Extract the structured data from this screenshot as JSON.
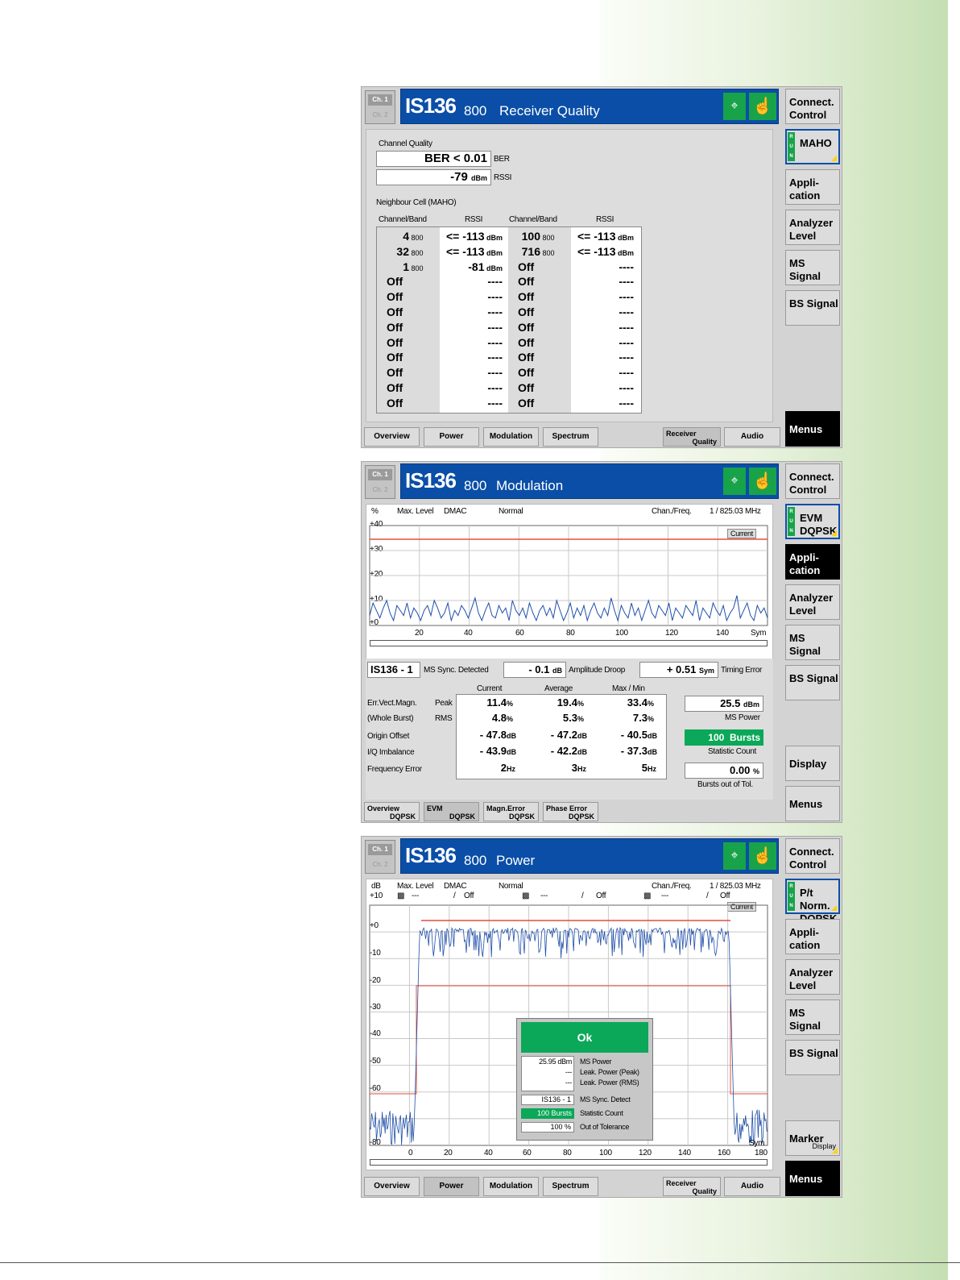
{
  "screen1": {
    "ch1": "Ch. 1",
    "ch2": "Ch. 2",
    "system": "IS136",
    "band": "800",
    "title": "Receiver Quality",
    "channel_quality_label": "Channel Quality",
    "ber_value": "BER < 0.01",
    "ber_label": "BER",
    "rssi_value": "-79",
    "rssi_unit": "dBm",
    "rssi_label": "RSSI",
    "neighbour_label": "Neighbour Cell (MAHO)",
    "col_headers": [
      "Channel/Band",
      "RSSI",
      "Channel/Band",
      "RSSI"
    ],
    "left_cells": [
      {
        "ch": "4",
        "band": "800",
        "rssi": "<= -113",
        "unit": "dBm"
      },
      {
        "ch": "32",
        "band": "800",
        "rssi": "<= -113",
        "unit": "dBm"
      },
      {
        "ch": "1",
        "band": "800",
        "rssi": "-81",
        "unit": "dBm"
      },
      {
        "ch": "Off",
        "band": "",
        "rssi": "----",
        "unit": ""
      },
      {
        "ch": "Off",
        "band": "",
        "rssi": "----",
        "unit": ""
      },
      {
        "ch": "Off",
        "band": "",
        "rssi": "----",
        "unit": ""
      },
      {
        "ch": "Off",
        "band": "",
        "rssi": "----",
        "unit": ""
      },
      {
        "ch": "Off",
        "band": "",
        "rssi": "----",
        "unit": ""
      },
      {
        "ch": "Off",
        "band": "",
        "rssi": "----",
        "unit": ""
      },
      {
        "ch": "Off",
        "band": "",
        "rssi": "----",
        "unit": ""
      },
      {
        "ch": "Off",
        "band": "",
        "rssi": "----",
        "unit": ""
      },
      {
        "ch": "Off",
        "band": "",
        "rssi": "----",
        "unit": ""
      }
    ],
    "right_cells": [
      {
        "ch": "100",
        "band": "800",
        "rssi": "<= -113",
        "unit": "dBm"
      },
      {
        "ch": "716",
        "band": "800",
        "rssi": "<= -113",
        "unit": "dBm"
      },
      {
        "ch": "Off",
        "band": "",
        "rssi": "----",
        "unit": ""
      },
      {
        "ch": "Off",
        "band": "",
        "rssi": "----",
        "unit": ""
      },
      {
        "ch": "Off",
        "band": "",
        "rssi": "----",
        "unit": ""
      },
      {
        "ch": "Off",
        "band": "",
        "rssi": "----",
        "unit": ""
      },
      {
        "ch": "Off",
        "band": "",
        "rssi": "----",
        "unit": ""
      },
      {
        "ch": "Off",
        "band": "",
        "rssi": "----",
        "unit": ""
      },
      {
        "ch": "Off",
        "band": "",
        "rssi": "----",
        "unit": ""
      },
      {
        "ch": "Off",
        "band": "",
        "rssi": "----",
        "unit": ""
      },
      {
        "ch": "Off",
        "band": "",
        "rssi": "----",
        "unit": ""
      },
      {
        "ch": "Off",
        "band": "",
        "rssi": "----",
        "unit": ""
      }
    ],
    "softkeys": [
      "Connect. Control",
      "MAHO",
      "Appli- cation",
      "Analyzer Level",
      "MS Signal",
      "BS Signal",
      "Menus"
    ],
    "hotkeys": [
      "Overview",
      "Power",
      "Modulation",
      "Spectrum",
      "Receiver",
      "Quality",
      "Audio"
    ]
  },
  "screen2": {
    "system": "IS136",
    "band": "800",
    "title": "Modulation",
    "header_left": [
      "%",
      "Max. Level",
      "DMAC",
      "Normal"
    ],
    "chan_freq_label": "Chan./Freq.",
    "chan_freq_value": "1 / 825.03 MHz",
    "current_label": "Current",
    "y_ticks": [
      "+40",
      "+30",
      "+20",
      "+10",
      "+0"
    ],
    "x_ticks": [
      "20",
      "40",
      "60",
      "80",
      "100",
      "120",
      "140",
      "Sym"
    ],
    "evm_trace": [
      4,
      9,
      6,
      3,
      7,
      10,
      5,
      2,
      8,
      6,
      4,
      9,
      3,
      7,
      5,
      2,
      6,
      8,
      4,
      10,
      7,
      3,
      5,
      9,
      2,
      6,
      4,
      8,
      6,
      3,
      7,
      11,
      5,
      2,
      6,
      9,
      4,
      3,
      8,
      5,
      7,
      2,
      10,
      6,
      4,
      7,
      3,
      9,
      5,
      2,
      6,
      8,
      4,
      7,
      3,
      10,
      6,
      2,
      5,
      9,
      3,
      7,
      4,
      8,
      2,
      6,
      9,
      5,
      3,
      7,
      4,
      11,
      6,
      2,
      8,
      5,
      3,
      9,
      4,
      7,
      2,
      6,
      10,
      5,
      3,
      8,
      6,
      4,
      9,
      2,
      7,
      5,
      3,
      8,
      6,
      4,
      10,
      2,
      7,
      5,
      3,
      9,
      6,
      4,
      8,
      2,
      5,
      7,
      12,
      3,
      6,
      9,
      4,
      2,
      8,
      5,
      7,
      3
    ],
    "sync_value": "IS136 - 1",
    "sync_label": "MS Sync. Detected",
    "droop_value": "- 0.1",
    "droop_unit": "dB",
    "droop_label": "Amplitude Droop",
    "timing_value": "+ 0.51",
    "timing_unit": "Sym",
    "timing_label": "Timing Error",
    "col_current": "Current",
    "col_average": "Average",
    "col_maxmin": "Max / Min",
    "row_labels": {
      "evm": "Err.Vect.Magn.",
      "whole": "(Whole Burst)",
      "peak": "Peak",
      "rms": "RMS",
      "origin": "Origin Offset",
      "iq": "I/Q Imbalance",
      "freq": "Frequency Error"
    },
    "current_vals": [
      {
        "v": "11.4",
        "u": "%"
      },
      {
        "v": "4.8",
        "u": "%"
      },
      {
        "v": "- 47.8",
        "u": "dB"
      },
      {
        "v": "- 43.9",
        "u": "dB"
      },
      {
        "v": "2",
        "u": "Hz"
      }
    ],
    "average_vals": [
      {
        "v": "19.4",
        "u": "%"
      },
      {
        "v": "5.3",
        "u": "%"
      },
      {
        "v": "- 47.2",
        "u": "dB"
      },
      {
        "v": "- 42.2",
        "u": "dB"
      },
      {
        "v": "3",
        "u": "Hz"
      }
    ],
    "maxmin_vals": [
      {
        "v": "33.4",
        "u": "%"
      },
      {
        "v": "7.3",
        "u": "%"
      },
      {
        "v": "- 40.5",
        "u": "dB"
      },
      {
        "v": "- 37.3",
        "u": "dB"
      },
      {
        "v": "5",
        "u": "Hz"
      }
    ],
    "ms_power_value": "25.5",
    "ms_power_unit": "dBm",
    "ms_power_label": "MS Power",
    "stat_value": "100",
    "stat_unit": "Bursts",
    "stat_label": "Statistic Count",
    "oot_value": "0.00",
    "oot_unit": "%",
    "oot_label": "Bursts out of Tol.",
    "softkeys": [
      "Connect. Control",
      "EVM DQPSK",
      "Appli- cation",
      "Analyzer Level",
      "MS Signal",
      "BS Signal",
      "Display",
      "Menus"
    ],
    "hotkeys": [
      [
        "Overview",
        "DQPSK"
      ],
      [
        "EVM",
        "DQPSK"
      ],
      [
        "Magn.Error",
        "DQPSK"
      ],
      [
        "Phase Error",
        "DQPSK"
      ]
    ]
  },
  "screen3": {
    "system": "IS136",
    "band": "800",
    "title": "Power",
    "header_left": [
      "dB",
      "Max. Level",
      "DMAC",
      "Normal"
    ],
    "marker_row": [
      "+10",
      "---",
      "/",
      "Off",
      "---",
      "/",
      "Off",
      "---",
      "/",
      "Off"
    ],
    "chan_freq_label": "Chan./Freq.",
    "chan_freq_value": "1 / 825.03 MHz",
    "current_label": "Current",
    "y_ticks": [
      "+0",
      "-10",
      "-20",
      "-30",
      "-40",
      "-50",
      "-60",
      "-80"
    ],
    "x_ticks": [
      "0",
      "20",
      "40",
      "60",
      "80",
      "100",
      "120",
      "140",
      "160",
      "180",
      "Sym"
    ],
    "ok_label": "Ok",
    "summary": [
      {
        "v": "25.95  dBm",
        "l": "MS Power"
      },
      {
        "v": "---",
        "l": "Leak. Power (Peak)"
      },
      {
        "v": "---",
        "l": "Leak. Power (RMS)"
      },
      {
        "v": "IS136 - 1",
        "l": "MS Sync. Detect"
      },
      {
        "v": "100 Bursts",
        "l": "Statistic Count"
      },
      {
        "v": "100  %",
        "l": "Out of Tolerance"
      }
    ],
    "softkeys": [
      "Connect. Control",
      "P/t Norm. DQPSK",
      "Appli- cation",
      "Analyzer Level",
      "MS Signal",
      "BS Signal",
      "Marker",
      "Display",
      "Menus"
    ],
    "hotkeys": [
      "Overview",
      "Power",
      "Modulation",
      "Spectrum",
      "Receiver",
      "Quality",
      "Audio"
    ]
  },
  "colors": {
    "title_blue": "#0a4ea7",
    "status_green": "#18a34a",
    "limit_red": "#e0503c",
    "trace_blue": "#1f4fa8"
  }
}
